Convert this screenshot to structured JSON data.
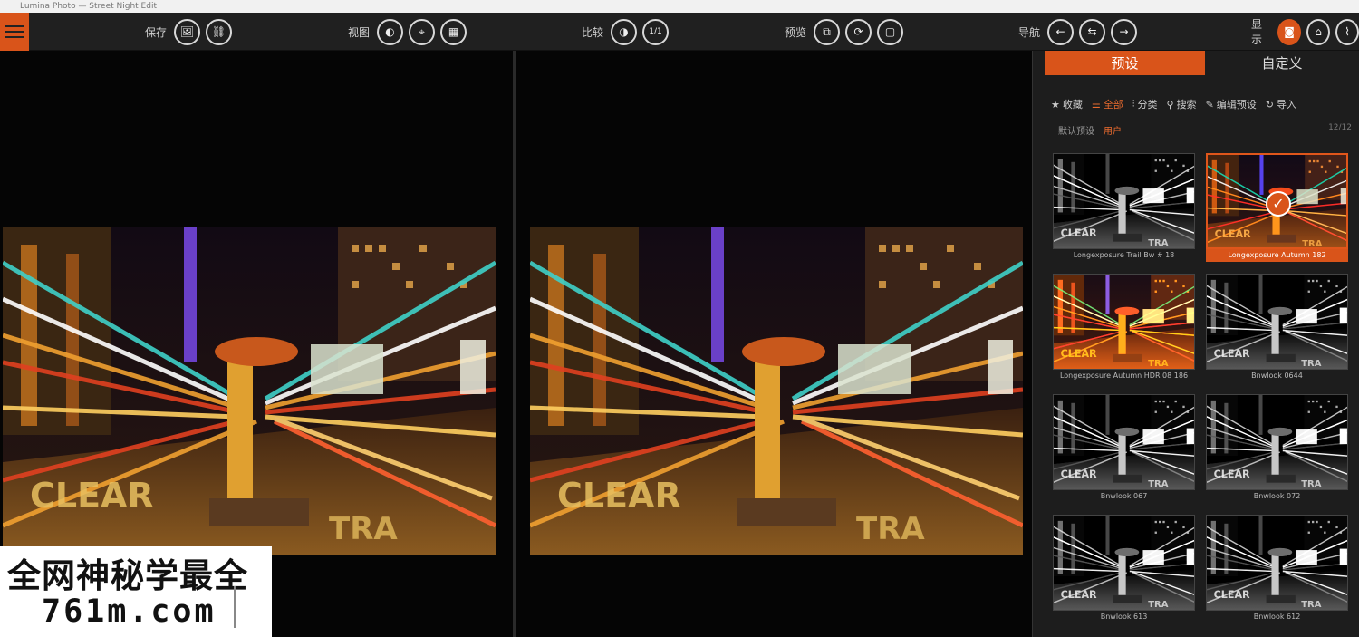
{
  "window": {
    "title": "Lumina Photo — Street Night Edit"
  },
  "toolbar": {
    "menu_icon": "hamburger-icon",
    "groups": [
      {
        "label": "保存",
        "buttons": [
          "🖼",
          "⛓"
        ]
      },
      {
        "label": "视图",
        "buttons": [
          "◐",
          "⌖",
          "▦"
        ]
      },
      {
        "label": "比较",
        "buttons": [
          "◑",
          "1/1"
        ]
      },
      {
        "label": "预览",
        "buttons": [
          "⧉",
          "⟳",
          "▢"
        ]
      },
      {
        "label": "导航",
        "buttons": [
          "←",
          "⇆",
          "→"
        ]
      },
      {
        "label": "显示",
        "buttons": [
          "◙",
          "⌂",
          "⌇"
        ]
      }
    ]
  },
  "panel": {
    "tabs": {
      "active": "预设",
      "other": "自定义"
    },
    "filters": [
      {
        "icon": "star-icon",
        "label": "收藏"
      },
      {
        "icon": "grid-icon",
        "label": "全部"
      },
      {
        "icon": "tag-icon",
        "label": "分类"
      },
      {
        "icon": "search-icon",
        "label": "搜索"
      },
      {
        "icon": "edit-icon",
        "label": "编辑预设"
      },
      {
        "icon": "refresh-icon",
        "label": "导入"
      }
    ],
    "sub": {
      "left": "默认预设",
      "active": "用户",
      "right": "12/12"
    },
    "presets": [
      {
        "name": "Longexposure Trail Bw # 18",
        "style": "bw"
      },
      {
        "name": "Longexposure Autumn 182",
        "style": "warm",
        "selected": true
      },
      {
        "name": "Longexposure Autumn HDR 08 186",
        "style": "fire"
      },
      {
        "name": "Bnwlook 0644",
        "style": "bw"
      },
      {
        "name": "Bnwlook 067",
        "style": "bw"
      },
      {
        "name": "Bnwlook 072",
        "style": "bw"
      },
      {
        "name": "Bnwlook 613",
        "style": "bw"
      },
      {
        "name": "Bnwlook 612",
        "style": "bw"
      }
    ]
  },
  "watermark": {
    "line1": "全网神秘学最全",
    "line2": "761m.com"
  }
}
